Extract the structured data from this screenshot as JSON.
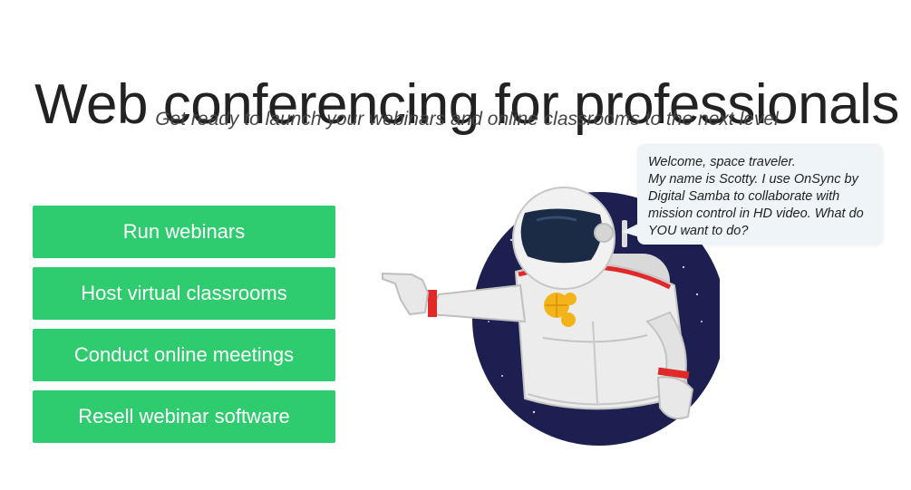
{
  "hero": {
    "title": "Web conferencing for professionals",
    "subtitle": "Get ready to launch your webinars and online classrooms to the next level"
  },
  "actions": [
    {
      "label": "Run webinars"
    },
    {
      "label": "Host virtual classrooms"
    },
    {
      "label": "Conduct online meetings"
    },
    {
      "label": "Resell webinar software"
    }
  ],
  "speech_bubble": {
    "lines": [
      "Welcome, space traveler.",
      "My name is Scotty. I use OnSync by",
      "Digital Samba to collaborate with",
      "mission control in HD video. What do",
      "YOU want to do?"
    ]
  },
  "colors": {
    "button_green": "#2ecc6e",
    "space_navy": "#1c1f4f",
    "suit_white": "#ececec",
    "stripe_red": "#e02a2a",
    "badge_gold": "#f2b418"
  },
  "icons": {
    "illustration": "astronaut-illustration",
    "badge": "logo-badge-icon"
  }
}
